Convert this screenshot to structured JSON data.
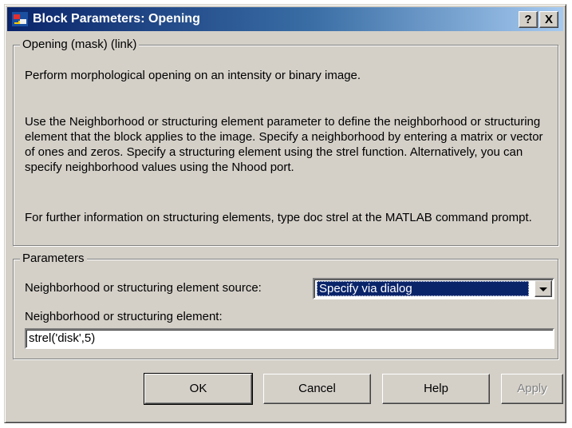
{
  "window": {
    "title": "Block Parameters: Opening",
    "help_glyph": "?",
    "close_glyph": "X"
  },
  "description_group": {
    "legend": "Opening (mask) (link)",
    "paragraphs": [
      "Perform morphological opening on an intensity or binary image.",
      "Use the Neighborhood or structuring element parameter to define the neighborhood or structuring element that the block applies to the image.  Specify a neighborhood by entering a matrix or vector of ones and zeros.  Specify a structuring element using the strel function.  Alternatively, you can specify neighborhood values using the Nhood port.",
      "For further information on structuring elements, type doc strel at the MATLAB command prompt."
    ]
  },
  "parameters_group": {
    "legend": "Parameters",
    "source_label": "Neighborhood or structuring element source:",
    "source_value": "Specify via dialog",
    "element_label": "Neighborhood or structuring element:",
    "element_value": "strel('disk',5)"
  },
  "buttons": {
    "ok": "OK",
    "cancel": "Cancel",
    "help": "Help",
    "apply": "Apply"
  },
  "icons": {
    "app": "simulink-block-icon",
    "dropdown": "chevron-down-icon"
  }
}
